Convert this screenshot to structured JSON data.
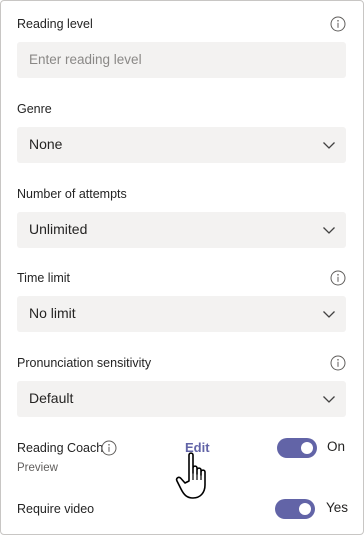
{
  "reading_level": {
    "label": "Reading level",
    "placeholder": "Enter reading level"
  },
  "genre": {
    "label": "Genre",
    "value": "None"
  },
  "attempts": {
    "label": "Number of attempts",
    "value": "Unlimited"
  },
  "time_limit": {
    "label": "Time limit",
    "value": "No limit"
  },
  "pronunciation": {
    "label": "Pronunciation sensitivity",
    "value": "Default"
  },
  "reading_coach": {
    "label": "Reading Coach",
    "sublabel": "Preview",
    "edit_label": "Edit",
    "toggle_state": "On"
  },
  "require_video": {
    "label": "Require video",
    "toggle_state": "Yes"
  },
  "colors": {
    "accent": "#6264a7",
    "field_bg": "#f3f2f1",
    "border": "#c8c6c4"
  },
  "icons": [
    "info-icon",
    "chevron-down-icon",
    "hand-pointer-icon"
  ]
}
